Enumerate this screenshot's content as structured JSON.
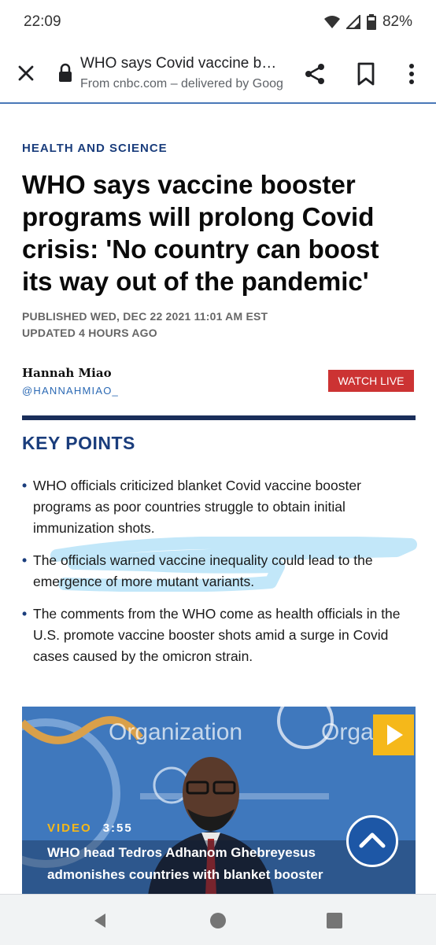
{
  "status_bar": {
    "time": "22:09",
    "battery": "82%",
    "icons": [
      "wifi-icon",
      "cell-signal-icon",
      "battery-icon"
    ]
  },
  "browser_toolbar": {
    "title": "WHO says Covid vaccine booster programs will prolong Covid crisis",
    "subtitle": "From cnbc.com – delivered by Google",
    "icons": [
      "close-icon",
      "lock-icon",
      "share-icon",
      "bookmark-icon",
      "more-vert-icon"
    ]
  },
  "article": {
    "section": "HEALTH AND SCIENCE",
    "headline": "WHO says vaccine booster programs will prolong Covid crisis: 'No country can boost its way out of the pandemic'",
    "published": "PUBLISHED WED, DEC 22 2021 11:01 AM EST",
    "updated": "UPDATED 4 HOURS AGO",
    "author": "Hannah Miao",
    "author_handle": "@HANNAHMIAO_",
    "watch_live": "WATCH LIVE"
  },
  "key_points": {
    "title": "KEY POINTS",
    "bullet": "•",
    "items": [
      "WHO officials criticized blanket Covid vaccine booster programs as poor countries struggle to obtain initial immunization shots.",
      "The officials warned vaccine inequality could lead to the emergence of more mutant variants.",
      "The comments from the WHO come as health officials in the U.S. promote vaccine booster shots amid a surge in Covid cases caused by the omicron strain."
    ],
    "highlight_color": "#8fd3f4"
  },
  "video": {
    "backdrop_text_left": "Organization",
    "backdrop_text_right": "Organ",
    "label": "VIDEO",
    "duration": "3:55",
    "caption": "WHO head Tedros Adhanom Ghebreyesus admonishes countries with blanket booster",
    "accent": "#f5b81a"
  },
  "colors": {
    "brand_blue": "#1a3d7c",
    "live_red": "#cc3333"
  }
}
